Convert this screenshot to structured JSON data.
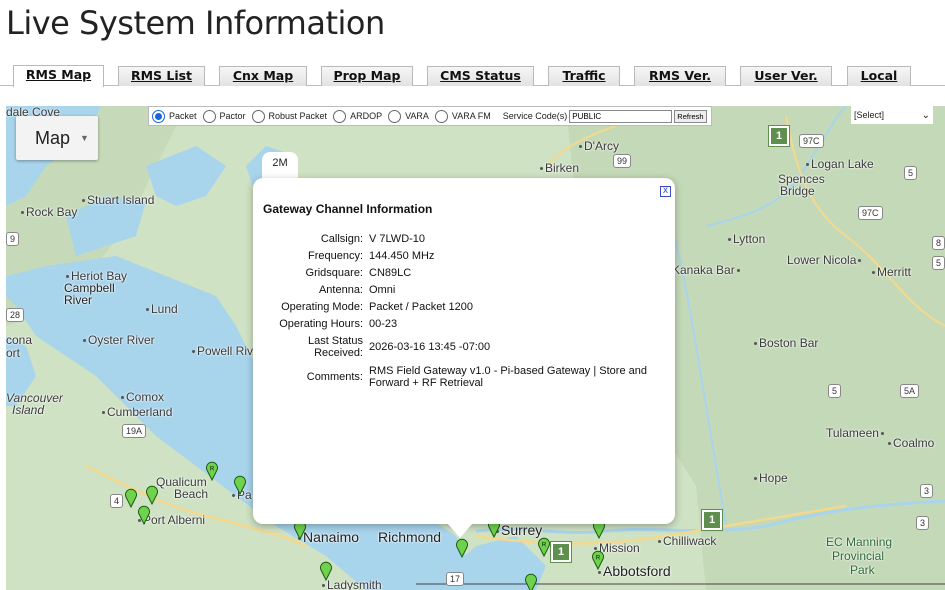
{
  "page": {
    "title": "Live System Information"
  },
  "tabs": [
    {
      "label": "RMS Map",
      "active": true
    },
    {
      "label": "RMS List",
      "active": false
    },
    {
      "label": "Cnx Map",
      "active": false
    },
    {
      "label": "Prop Map",
      "active": false
    },
    {
      "label": "CMS Status",
      "active": false
    },
    {
      "label": "Traffic",
      "active": false
    },
    {
      "label": "RMS Ver.",
      "active": false
    },
    {
      "label": "User Ver.",
      "active": false
    },
    {
      "label": "Local",
      "active": false
    }
  ],
  "map_controls": {
    "map_type_label": "Map",
    "modes": [
      {
        "label": "Packet",
        "selected": true
      },
      {
        "label": "Pactor",
        "selected": false
      },
      {
        "label": "Robust Packet",
        "selected": false
      },
      {
        "label": "ARDOP",
        "selected": false
      },
      {
        "label": "VARA",
        "selected": false
      },
      {
        "label": "VARA FM",
        "selected": false
      }
    ],
    "service_code_label": "Service Code(s)",
    "service_code_value": "PUBLIC",
    "refresh_label": "Refresh",
    "select_value": "[Select]"
  },
  "places": [
    "dale Cove",
    "Rock Bay",
    "Stuart Island",
    "Heriot Bay",
    "Campbell",
    "River",
    "Lund",
    "Oyster River",
    "Powell Riv",
    "cona",
    "ort",
    "Comox",
    "Cumberland",
    "Vancouver",
    "Island",
    "Qualicum",
    "Beach",
    "Pa",
    "Port Alberni",
    "Nanaimo",
    "Richmond",
    "Ladysmith",
    "Surrey",
    "Mission",
    "Abbotsford",
    "Chilliwack",
    "D'Arcy",
    "Birken",
    "Logan Lake",
    "Spences",
    "Bridge",
    "Lytton",
    "Kanaka Bar",
    "Lower Nicola",
    "Merritt",
    "Boston Bar",
    "Tulameen",
    "Coalmo",
    "Hope",
    "EC Manning",
    "Provincial",
    "Park"
  ],
  "shields": [
    "97C",
    "5",
    "97C",
    "99",
    "9",
    "28",
    "19A",
    "4",
    "17",
    "5",
    "5A",
    "3",
    "3",
    "8",
    "5",
    "1"
  ],
  "popup": {
    "tab_label": "2M",
    "title": "Gateway Channel Information",
    "close_label": "x",
    "fields": [
      {
        "label": "Callsign:",
        "value": "V  7LWD-10"
      },
      {
        "label": "Frequency:",
        "value": "144.450 MHz"
      },
      {
        "label": "Gridsquare:",
        "value": "CN89LC"
      },
      {
        "label": "Antenna:",
        "value": "Omni"
      },
      {
        "label": "Operating Mode:",
        "value": "Packet / Packet 1200"
      },
      {
        "label": "Operating Hours:",
        "value": "00-23"
      },
      {
        "label": "Last Status Received:",
        "value": "2026-03-16 13:45 -07:00"
      },
      {
        "label": "Comments:",
        "value": "RMS Field Gateway v1.0 - Pi-based Gateway | Store and Forward + RF Retrieval"
      }
    ]
  },
  "colors": {
    "water": "#a8d4ec",
    "land": "#cfe2c4",
    "mountain": "#b9cdb0",
    "pin_green": "#6fd24d",
    "radio_selected": "#1a66d9"
  }
}
